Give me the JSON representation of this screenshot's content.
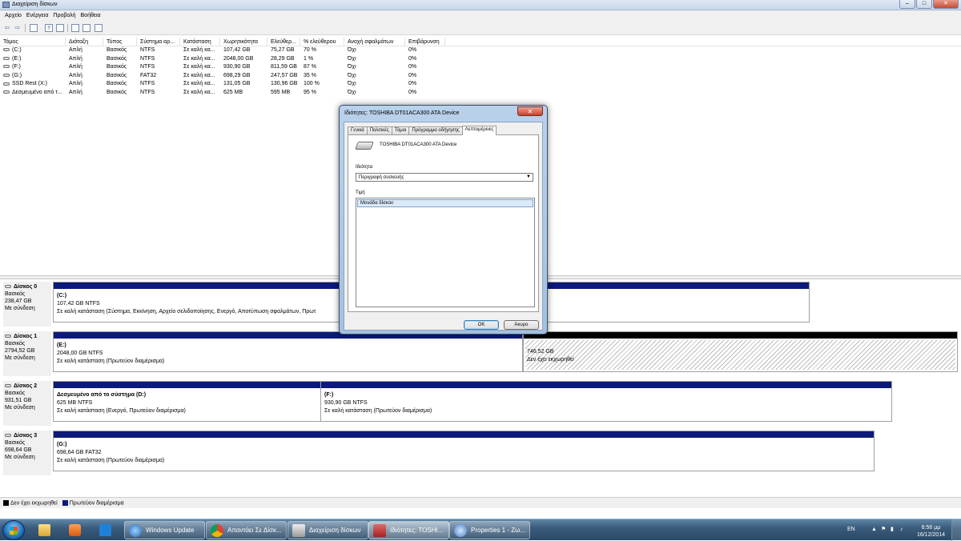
{
  "window": {
    "title": "Διαχείριση δίσκων",
    "buttons": [
      "–",
      "□",
      "✕"
    ]
  },
  "menu": [
    "Αρχείο",
    "Ενέργεια",
    "Προβολή",
    "Βοήθεια"
  ],
  "toolbar": {
    "help_glyph": "?",
    "back_glyph": "⇦",
    "forward_glyph": "⇨"
  },
  "volume_table": {
    "headers": [
      "Τόμος",
      "Διάταξη",
      "Τύπος",
      "Σύστημα αρ...",
      "Κατάσταση",
      "Χωρητικότητα",
      "Ελεύθερ...",
      "% ελεύθερου",
      "Ανοχή σφαλμάτων",
      "Επιβάρυνση"
    ],
    "rows": [
      [
        "(C:)",
        "Απλή",
        "Βασικός",
        "NTFS",
        "Σε καλή κα...",
        "107,42 GB",
        "75,27 GB",
        "70 %",
        "Όχι",
        "0%"
      ],
      [
        "(E:)",
        "Απλή",
        "Βασικός",
        "NTFS",
        "Σε καλή κα...",
        "2048,00 GB",
        "28,29 GB",
        "1 %",
        "Όχι",
        "0%"
      ],
      [
        "(F:)",
        "Απλή",
        "Βασικός",
        "NTFS",
        "Σε καλή κα...",
        "930,90 GB",
        "811,59 GB",
        "87 %",
        "Όχι",
        "0%"
      ],
      [
        "(G:)",
        "Απλή",
        "Βασικός",
        "FAT32",
        "Σε καλή κα...",
        "698,29 GB",
        "247,57 GB",
        "35 %",
        "Όχι",
        "0%"
      ],
      [
        "SSD Rest (X:)",
        "Απλή",
        "Βασικός",
        "NTFS",
        "Σε καλή κα...",
        "131,05 GB",
        "130,96 GB",
        "100 %",
        "Όχι",
        "0%"
      ],
      [
        "Δεσμευμένο από τ...",
        "Απλή",
        "Βασικός",
        "NTFS",
        "Σε καλή κα...",
        "625 MB",
        "595 MB",
        "95 %",
        "Όχι",
        "0%"
      ]
    ]
  },
  "disks": [
    {
      "name": "Δίσκος 0",
      "type": "Βασικός",
      "size": "238,47 GB",
      "status": "Με σύνδεση",
      "partitions": [
        {
          "name": "(C:)",
          "size": "107,42 GB NTFS",
          "status": "Σε καλή κατάσταση (Σύστημα, Εκκίνηση, Αρχείο σελιδοποίησης, Ενεργό, Αποτύπωση σφαλμάτων, Πρωτ"
        }
      ]
    },
    {
      "name": "Δίσκος 1",
      "type": "Βασικός",
      "size": "2794,52 GB",
      "status": "Με σύνδεση",
      "partitions": [
        {
          "name": "(E:)",
          "size": "2048,00 GB NTFS",
          "status": "Σε καλή κατάσταση (Πρωτεύον διαμέρισμα)"
        },
        {
          "name": "",
          "size": "746,52 GB",
          "status": "Δεν έχει εκχωρηθεί"
        }
      ]
    },
    {
      "name": "Δίσκος 2",
      "type": "Βασικός",
      "size": "931,51 GB",
      "status": "Με σύνδεση",
      "partitions": [
        {
          "name": "Δεσμευμένο από το σύστημα  (D:)",
          "size": "625 MB NTFS",
          "status": "Σε καλή κατάσταση (Ενεργό, Πρωτεύον διαμέρισμα)"
        },
        {
          "name": "(F:)",
          "size": "930,90 GB NTFS",
          "status": "Σε καλή κατάσταση (Πρωτεύον διαμέρισμα)"
        }
      ]
    },
    {
      "name": "Δίσκος 3",
      "type": "Βασικός",
      "size": "698,64 GB",
      "status": "Με σύνδεση",
      "partitions": [
        {
          "name": "(G:)",
          "size": "698,64 GB FAT32",
          "status": "Σε καλή κατάσταση (Πρωτεύον διαμέρισμα)"
        }
      ]
    }
  ],
  "legend": [
    {
      "label": "Δεν έχει εκχωρηθεί",
      "color": "#000000"
    },
    {
      "label": "Πρωτεύον διαμέρισμα",
      "color": "#0c1a7a"
    }
  ],
  "dialog": {
    "title": "Ιδιότητες: TOSHIBA DT01ACA300 ATA Device",
    "close": "✕",
    "tabs": [
      "Γενικά",
      "Πολιτικές",
      "Τόμοι",
      "Πρόγραμμα οδήγησης",
      "Λεπτομέρειες"
    ],
    "active_tab": "Λεπτομέρειες",
    "device_name": "TOSHIBA DT01ACA300 ATA Device",
    "property_label": "Ιδιότητα",
    "property_value": "Περιγραφή συσκευής",
    "value_label": "Τιμή",
    "value_item": "Μονάδα δίσκου",
    "ok": "OK",
    "cancel": "Άκυρο"
  },
  "taskbar": {
    "tasks": [
      "Windows Update",
      "Απαντάει Σε Δίσκ...",
      "Διαχείριση δίσκων",
      "Ιδιότητες: TOSHI...",
      "Properties 1 - Ζω..."
    ],
    "active_task": "Ιδιότητες: TOSHI...",
    "language": "EN",
    "time": "6:56 μμ",
    "date": "16/12/2014"
  }
}
